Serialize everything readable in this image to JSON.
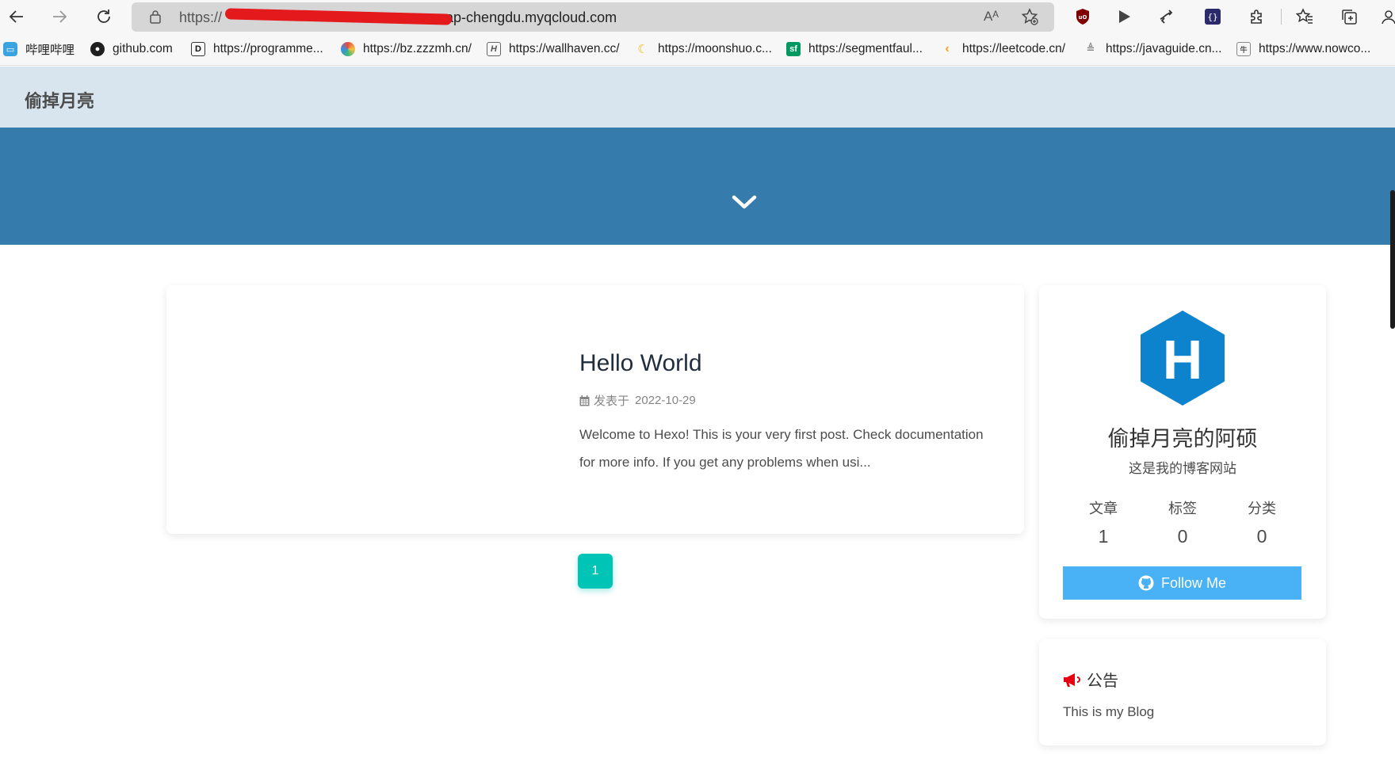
{
  "browser": {
    "url_prefix": "https://",
    "url_host": "ap-chengdu.myqcloud.com",
    "read_aloud": "Aᴬ"
  },
  "bookmarks": [
    {
      "label": "哔哩哔哩",
      "icon": "bilibili-icon"
    },
    {
      "label": "github.com",
      "icon": "github-icon"
    },
    {
      "label": "https://programme...",
      "icon": "programmer-icon"
    },
    {
      "label": "https://bz.zzzmh.cn/",
      "icon": "zzzmh-icon"
    },
    {
      "label": "https://wallhaven.cc/",
      "icon": "wallhaven-icon"
    },
    {
      "label": "https://moonshuo.c...",
      "icon": "moon-icon"
    },
    {
      "label": "https://segmentfaul...",
      "icon": "segmentfault-icon"
    },
    {
      "label": "https://leetcode.cn/",
      "icon": "leetcode-icon"
    },
    {
      "label": "https://javaguide.cn...",
      "icon": "javaguide-icon"
    },
    {
      "label": "https://www.nowco...",
      "icon": "nowcoder-icon"
    }
  ],
  "site": {
    "title": "偷掉月亮"
  },
  "post": {
    "title": "Hello World",
    "meta_label": "发表于",
    "date": "2022-10-29",
    "excerpt": "Welcome to Hexo! This is your very first post. Check documentation for more info. If you get any problems when usi..."
  },
  "pagination": {
    "current": "1"
  },
  "author": {
    "avatar_letter": "H",
    "name": "偷掉月亮的阿硕",
    "description": "这是我的博客网站",
    "stats": [
      {
        "label": "文章",
        "value": "1"
      },
      {
        "label": "标签",
        "value": "0"
      },
      {
        "label": "分类",
        "value": "0"
      }
    ],
    "follow_label": "Follow Me"
  },
  "announcement": {
    "title": "公告",
    "body": "This is my Blog"
  },
  "colors": {
    "banner": "#357bac",
    "nav": "#d8e5ef",
    "accent": "#00c4b6",
    "follow": "#49b1f5",
    "hexo_logo": "#0e83cd"
  }
}
